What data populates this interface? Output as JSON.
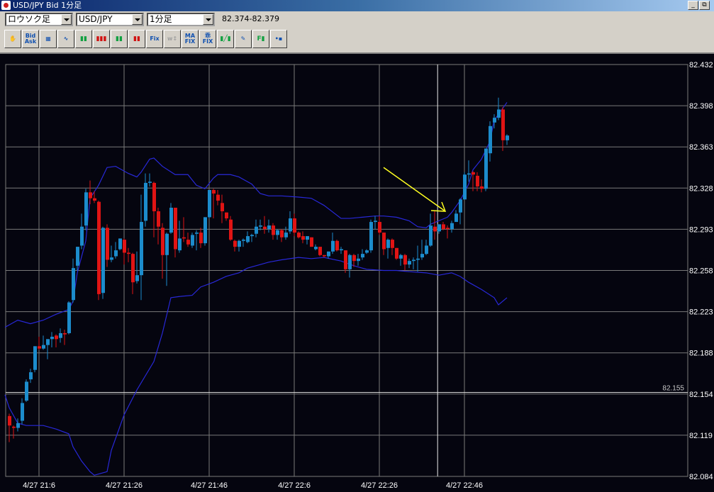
{
  "window": {
    "title": "USD/JPY Bid 1分足",
    "minimize_label": "_",
    "restore_label": "⧉"
  },
  "controls": {
    "chart_type": "ロウソク足",
    "pair": "USD/JPY",
    "interval": "1分足",
    "quote_range": "82.374-82.379"
  },
  "toolbar": [
    {
      "icon": "hand-icon",
      "text": "✋"
    },
    {
      "icon": "bid-ask-icon",
      "text": "Bid",
      "sub": "Ask"
    },
    {
      "icon": "indicator-window-icon",
      "text": "▦"
    },
    {
      "icon": "oscillator-icon",
      "text": "∿"
    },
    {
      "icon": "candle-chart-icon",
      "text": "▮▮"
    },
    {
      "icon": "large-candles-icon",
      "text": "▮▮▮"
    },
    {
      "icon": "medium-candles-icon",
      "text": "▮▮"
    },
    {
      "icon": "small-candles-icon",
      "text": "▮▮"
    },
    {
      "icon": "fix-icon",
      "text": "Fix"
    },
    {
      "icon": "scale-icon",
      "text": "w↕",
      "disabled": true
    },
    {
      "icon": "ma-fix-icon",
      "text": "MA",
      "sub": "FIX"
    },
    {
      "icon": "deviation-fix-icon",
      "text": "乖",
      "sub": "FIX"
    },
    {
      "icon": "trendline-icon",
      "text": "▮╱▮"
    },
    {
      "icon": "pencil-icon",
      "text": "✎"
    },
    {
      "icon": "fibonacci-icon",
      "text": "F▮"
    },
    {
      "icon": "save-icon",
      "text": "•▪"
    }
  ],
  "chart_data": {
    "type": "candlestick",
    "date": "4/27",
    "ylim": [
      82.084,
      82.432
    ],
    "y_tick_labels": [
      "82.432",
      "82.398",
      "82.363",
      "82.328",
      "82.293",
      "82.258",
      "82.223",
      "82.188",
      "82.154",
      "82.119",
      "82.084"
    ],
    "x_tick_labels": [
      "4/27 21:6",
      "4/27 21:26",
      "4/27 21:46",
      "4/27 22:6",
      "4/27 22:26",
      "4/27 22:46"
    ],
    "x_tick_times": [
      "21:06",
      "21:26",
      "21:46",
      "22:06",
      "22:26",
      "22:46"
    ],
    "grid": true,
    "colors": {
      "background": "#05050f",
      "grid": "#7a7a7a",
      "up": "#1c8ccc",
      "down": "#e01414",
      "band": "#2828d8",
      "annotation": "#ffff20",
      "price_line": "#d8d8d8",
      "axis_text": "#ffffff"
    },
    "price_line": {
      "value": 82.155,
      "label": "82.155"
    },
    "crosshair_time": "22:39.7",
    "arrow": {
      "from": [
        "22:27",
        82.345
      ],
      "to": [
        "22:42",
        82.308
      ]
    },
    "candle_fields": [
      "time",
      "open",
      "high",
      "low",
      "close"
    ],
    "candles": [
      [
        "20:59",
        82.135,
        82.137,
        82.113,
        82.127
      ],
      [
        "21:00",
        82.126,
        82.127,
        82.116,
        82.125
      ],
      [
        "21:01",
        82.125,
        82.133,
        82.122,
        82.129
      ],
      [
        "21:02",
        82.131,
        82.15,
        82.128,
        82.146
      ],
      [
        "21:03",
        82.148,
        82.166,
        82.147,
        82.164
      ],
      [
        "21:04",
        82.166,
        82.175,
        82.163,
        82.172
      ],
      [
        "21:05",
        82.174,
        82.194,
        82.172,
        82.194
      ],
      [
        "21:06",
        82.194,
        82.202,
        82.191,
        82.192
      ],
      [
        "21:07",
        82.192,
        82.203,
        82.191,
        82.195
      ],
      [
        "21:08",
        82.195,
        82.2,
        82.183,
        82.2
      ],
      [
        "21:09",
        82.2,
        82.206,
        82.193,
        82.202
      ],
      [
        "21:10",
        82.203,
        82.204,
        82.193,
        82.2
      ],
      [
        "21:11",
        82.201,
        82.209,
        82.197,
        82.205
      ],
      [
        "21:12",
        82.205,
        82.208,
        82.195,
        82.204
      ],
      [
        "21:13",
        82.205,
        82.232,
        82.204,
        82.231
      ],
      [
        "21:14",
        82.233,
        82.268,
        82.231,
        82.26
      ],
      [
        "21:15",
        82.262,
        82.278,
        82.258,
        82.278
      ],
      [
        "21:16",
        82.279,
        82.306,
        82.276,
        82.295
      ],
      [
        "21:17",
        82.296,
        82.327,
        82.292,
        82.324
      ],
      [
        "21:18",
        82.324,
        82.334,
        82.314,
        82.319
      ],
      [
        "21:19",
        82.319,
        82.325,
        82.315,
        82.317
      ],
      [
        "21:20",
        82.316,
        82.317,
        82.233,
        82.238
      ],
      [
        "21:21",
        82.239,
        82.295,
        82.234,
        82.294
      ],
      [
        "21:22",
        82.294,
        82.297,
        82.261,
        82.267
      ],
      [
        "21:23",
        82.267,
        82.279,
        82.265,
        82.269
      ],
      [
        "21:24",
        82.27,
        82.282,
        82.268,
        82.275
      ],
      [
        "21:25",
        82.276,
        82.285,
        82.275,
        82.285
      ],
      [
        "21:26",
        82.284,
        82.285,
        82.263,
        82.273
      ],
      [
        "21:27",
        82.273,
        82.277,
        82.265,
        82.272
      ],
      [
        "21:28",
        82.272,
        82.273,
        82.238,
        82.248
      ],
      [
        "21:29",
        82.249,
        82.274,
        82.247,
        82.254
      ],
      [
        "21:30",
        82.254,
        82.322,
        82.233,
        82.299
      ],
      [
        "21:31",
        82.3,
        82.34,
        82.295,
        82.332
      ],
      [
        "21:32",
        82.332,
        82.34,
        82.329,
        82.333
      ],
      [
        "21:33",
        82.332,
        82.333,
        82.286,
        82.308
      ],
      [
        "21:34",
        82.308,
        82.311,
        82.28,
        82.295
      ],
      [
        "21:35",
        82.294,
        82.298,
        82.251,
        82.271
      ],
      [
        "21:36",
        82.271,
        82.29,
        82.245,
        82.289
      ],
      [
        "21:37",
        82.29,
        82.315,
        82.289,
        82.311
      ],
      [
        "21:38",
        82.311,
        82.311,
        82.269,
        82.276
      ],
      [
        "21:39",
        82.275,
        82.3,
        82.273,
        82.285
      ],
      [
        "21:40",
        82.286,
        82.303,
        82.282,
        82.285
      ],
      [
        "21:41",
        82.284,
        82.29,
        82.278,
        82.28
      ],
      [
        "21:42",
        82.279,
        82.29,
        82.277,
        82.288
      ],
      [
        "21:43",
        82.289,
        82.292,
        82.275,
        82.29
      ],
      [
        "21:44",
        82.29,
        82.294,
        82.277,
        82.281
      ],
      [
        "21:45",
        82.281,
        82.303,
        82.279,
        82.303
      ],
      [
        "21:46",
        82.303,
        82.326,
        82.302,
        82.326
      ],
      [
        "21:47",
        82.326,
        82.327,
        82.302,
        82.323
      ],
      [
        "21:48",
        82.322,
        82.326,
        82.313,
        82.317
      ],
      [
        "21:49",
        82.315,
        82.322,
        82.298,
        82.308
      ],
      [
        "21:50",
        82.307,
        82.307,
        82.3,
        82.302
      ],
      [
        "21:51",
        82.301,
        82.304,
        82.283,
        82.284
      ],
      [
        "21:52",
        82.283,
        82.284,
        82.274,
        82.278
      ],
      [
        "21:53",
        82.278,
        82.284,
        82.274,
        82.283
      ],
      [
        "21:54",
        82.283,
        82.285,
        82.278,
        82.284
      ],
      [
        "21:55",
        82.282,
        82.291,
        82.281,
        82.287
      ],
      [
        "21:56",
        82.287,
        82.289,
        82.282,
        82.288
      ],
      [
        "21:57",
        82.289,
        82.301,
        82.286,
        82.295
      ],
      [
        "21:58",
        82.295,
        82.301,
        82.292,
        82.296
      ],
      [
        "21:59",
        82.295,
        82.304,
        82.289,
        82.293
      ],
      [
        "22:00",
        82.293,
        82.301,
        82.29,
        82.296
      ],
      [
        "22:01",
        82.296,
        82.298,
        82.284,
        82.288
      ],
      [
        "22:02",
        82.288,
        82.293,
        82.284,
        82.292
      ],
      [
        "22:03",
        82.292,
        82.293,
        82.282,
        82.286
      ],
      [
        "22:04",
        82.286,
        82.295,
        82.284,
        82.29
      ],
      [
        "22:05",
        82.291,
        82.308,
        82.289,
        82.302
      ],
      [
        "22:06",
        82.302,
        82.306,
        82.287,
        82.29
      ],
      [
        "22:07",
        82.29,
        82.291,
        82.285,
        82.286
      ],
      [
        "22:08",
        82.287,
        82.291,
        82.281,
        82.284
      ],
      [
        "22:09",
        82.284,
        82.287,
        82.28,
        82.287
      ],
      [
        "22:10",
        82.286,
        82.286,
        82.278,
        82.278
      ],
      [
        "22:11",
        82.276,
        82.28,
        82.275,
        82.278
      ],
      [
        "22:12",
        82.278,
        82.278,
        82.27,
        82.271
      ],
      [
        "22:13",
        82.271,
        82.271,
        82.269,
        82.27
      ],
      [
        "22:14",
        82.27,
        82.274,
        82.268,
        82.274
      ],
      [
        "22:15",
        82.274,
        82.29,
        82.272,
        82.283
      ],
      [
        "22:16",
        82.283,
        82.284,
        82.274,
        82.275
      ],
      [
        "22:17",
        82.275,
        82.278,
        82.272,
        82.276
      ],
      [
        "22:18",
        82.275,
        82.275,
        82.256,
        82.259
      ],
      [
        "22:19",
        82.259,
        82.272,
        82.252,
        82.271
      ],
      [
        "22:20",
        82.271,
        82.272,
        82.261,
        82.266
      ],
      [
        "22:21",
        82.266,
        82.272,
        82.262,
        82.268
      ],
      [
        "22:22",
        82.269,
        82.276,
        82.267,
        82.272
      ],
      [
        "22:23",
        82.273,
        82.276,
        82.272,
        82.275
      ],
      [
        "22:24",
        82.275,
        82.301,
        82.273,
        82.299
      ],
      [
        "22:25",
        82.299,
        82.304,
        82.293,
        82.3
      ],
      [
        "22:26",
        82.299,
        82.304,
        82.288,
        82.29
      ],
      [
        "22:27",
        82.29,
        82.29,
        82.271,
        82.276
      ],
      [
        "22:28",
        82.277,
        82.285,
        82.268,
        82.284
      ],
      [
        "22:29",
        82.284,
        82.285,
        82.271,
        82.277
      ],
      [
        "22:30",
        82.277,
        82.277,
        82.267,
        82.268
      ],
      [
        "22:31",
        82.268,
        82.272,
        82.262,
        82.271
      ],
      [
        "22:32",
        82.271,
        82.272,
        82.258,
        82.263
      ],
      [
        "22:33",
        82.263,
        82.268,
        82.26,
        82.266
      ],
      [
        "22:34",
        82.266,
        82.269,
        82.259,
        82.267
      ],
      [
        "22:35",
        82.267,
        82.279,
        82.257,
        82.268
      ],
      [
        "22:36",
        82.269,
        82.284,
        82.267,
        82.272
      ],
      [
        "22:37",
        82.272,
        82.284,
        82.271,
        82.279
      ],
      [
        "22:38",
        82.279,
        82.306,
        82.278,
        82.296
      ],
      [
        "22:39",
        82.295,
        82.308,
        82.284,
        82.291
      ],
      [
        "22:40",
        82.291,
        82.297,
        82.289,
        82.297
      ],
      [
        "22:41",
        82.297,
        82.299,
        82.292,
        82.293
      ],
      [
        "22:42",
        82.294,
        82.296,
        82.285,
        82.293
      ],
      [
        "22:43",
        82.293,
        82.3,
        82.29,
        82.298
      ],
      [
        "22:44",
        82.299,
        82.309,
        82.299,
        82.306
      ],
      [
        "22:45",
        82.307,
        82.319,
        82.297,
        82.318
      ],
      [
        "22:46",
        82.318,
        82.341,
        82.318,
        82.339
      ],
      [
        "22:47",
        82.339,
        82.351,
        82.333,
        82.34
      ],
      [
        "22:48",
        82.341,
        82.342,
        82.325,
        82.339
      ],
      [
        "22:49",
        82.338,
        82.341,
        82.325,
        82.329
      ],
      [
        "22:50",
        82.329,
        82.335,
        82.324,
        82.327
      ],
      [
        "22:51",
        82.327,
        82.361,
        82.325,
        82.361
      ],
      [
        "22:52",
        82.357,
        82.384,
        82.35,
        82.38
      ],
      [
        "22:53",
        82.383,
        82.39,
        82.378,
        82.387
      ],
      [
        "22:54",
        82.387,
        82.404,
        82.385,
        82.394
      ],
      [
        "22:55",
        82.394,
        82.396,
        82.359,
        82.368
      ],
      [
        "22:56",
        82.368,
        82.373,
        82.364,
        82.372
      ]
    ],
    "upper_band": [
      [
        "20:58",
        82.21
      ],
      [
        "21:01",
        82.216
      ],
      [
        "21:04",
        82.213
      ],
      [
        "21:07",
        82.216
      ],
      [
        "21:10",
        82.221
      ],
      [
        "21:13",
        82.225
      ],
      [
        "21:14",
        82.232
      ],
      [
        "21:15",
        82.256
      ],
      [
        "21:17",
        82.283
      ],
      [
        "21:18",
        82.319
      ],
      [
        "21:20",
        82.33
      ],
      [
        "21:22",
        82.345
      ],
      [
        "21:24",
        82.346
      ],
      [
        "21:27",
        82.34
      ],
      [
        "21:29",
        82.337
      ],
      [
        "21:30",
        82.341
      ],
      [
        "21:32",
        82.352
      ],
      [
        "21:33",
        82.353
      ],
      [
        "21:35",
        82.346
      ],
      [
        "21:38",
        82.339
      ],
      [
        "21:41",
        82.339
      ],
      [
        "21:43",
        82.33
      ],
      [
        "21:45",
        82.327
      ],
      [
        "21:47",
        82.336
      ],
      [
        "21:48",
        82.339
      ],
      [
        "21:51",
        82.339
      ],
      [
        "21:53",
        82.337
      ],
      [
        "21:56",
        82.331
      ],
      [
        "21:58",
        82.323
      ],
      [
        "22:00",
        82.321
      ],
      [
        "22:03",
        82.321
      ],
      [
        "22:07",
        82.32
      ],
      [
        "22:10",
        82.319
      ],
      [
        "22:13",
        82.313
      ],
      [
        "22:17",
        82.302
      ],
      [
        "22:19",
        82.302
      ],
      [
        "22:22",
        82.303
      ],
      [
        "22:25",
        82.304
      ],
      [
        "22:27",
        82.304
      ],
      [
        "22:30",
        82.303
      ],
      [
        "22:33",
        82.3
      ],
      [
        "22:35",
        82.295
      ],
      [
        "22:37",
        82.294
      ],
      [
        "22:38",
        82.297
      ],
      [
        "22:40",
        82.3
      ],
      [
        "22:42",
        82.303
      ],
      [
        "22:43",
        82.307
      ],
      [
        "22:45",
        82.317
      ],
      [
        "22:47",
        82.331
      ],
      [
        "22:48",
        82.343
      ],
      [
        "22:50",
        82.352
      ],
      [
        "22:52",
        82.367
      ],
      [
        "22:53",
        82.385
      ],
      [
        "22:56",
        82.4
      ]
    ],
    "lower_band": [
      [
        "20:58",
        82.153
      ],
      [
        "20:59",
        82.142
      ],
      [
        "21:01",
        82.129
      ],
      [
        "21:03",
        82.127
      ],
      [
        "21:07",
        82.127
      ],
      [
        "21:10",
        82.124
      ],
      [
        "21:13",
        82.12
      ],
      [
        "21:14",
        82.109
      ],
      [
        "21:16",
        82.097
      ],
      [
        "21:18",
        82.088
      ],
      [
        "21:19",
        82.085
      ],
      [
        "21:22",
        82.088
      ],
      [
        "21:23",
        82.106
      ],
      [
        "21:26",
        82.136
      ],
      [
        "21:29",
        82.157
      ],
      [
        "21:33",
        82.181
      ],
      [
        "21:35",
        82.205
      ],
      [
        "21:37",
        82.235
      ],
      [
        "21:39",
        82.236
      ],
      [
        "21:42",
        82.237
      ],
      [
        "21:44",
        82.244
      ],
      [
        "21:47",
        82.248
      ],
      [
        "21:50",
        82.253
      ],
      [
        "21:53",
        82.256
      ],
      [
        "21:55",
        82.26
      ],
      [
        "21:58",
        82.263
      ],
      [
        "22:00",
        82.265
      ],
      [
        "22:03",
        82.267
      ],
      [
        "22:07",
        82.269
      ],
      [
        "22:10",
        82.268
      ],
      [
        "22:13",
        82.269
      ],
      [
        "22:17",
        82.266
      ],
      [
        "22:20",
        82.262
      ],
      [
        "22:23",
        82.259
      ],
      [
        "22:27",
        82.258
      ],
      [
        "22:30",
        82.258
      ],
      [
        "22:33",
        82.257
      ],
      [
        "22:37",
        82.256
      ],
      [
        "22:40",
        82.254
      ],
      [
        "22:43",
        82.256
      ],
      [
        "22:45",
        82.253
      ],
      [
        "22:47",
        82.248
      ],
      [
        "22:50",
        82.242
      ],
      [
        "22:53",
        82.235
      ],
      [
        "22:54",
        82.229
      ],
      [
        "22:56",
        82.235
      ]
    ]
  }
}
